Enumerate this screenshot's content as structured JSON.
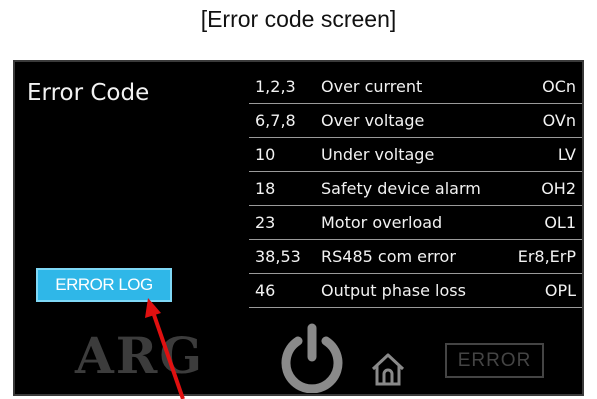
{
  "caption": "[Error code screen]",
  "screen": {
    "title": "Error Code",
    "rows": [
      {
        "code": "1,2,3",
        "description": "Over current",
        "abbr": "OCn"
      },
      {
        "code": "6,7,8",
        "description": "Over voltage",
        "abbr": "OVn"
      },
      {
        "code": "10",
        "description": "Under voltage",
        "abbr": "LV"
      },
      {
        "code": "18",
        "description": "Safety device alarm",
        "abbr": "OH2"
      },
      {
        "code": "23",
        "description": "Motor overload",
        "abbr": "OL1"
      },
      {
        "code": "38,53",
        "description": "RS485 com error",
        "abbr": "Er8,ErP"
      },
      {
        "code": "46",
        "description": "Output phase loss",
        "abbr": "OPL"
      }
    ],
    "error_log_button": "ERROR LOG",
    "logo": "ARG",
    "error_button": "ERROR",
    "icons": {
      "power": "power-icon",
      "home": "home-icon"
    }
  },
  "colors": {
    "screen_bg": "#000000",
    "button_blue": "#2fb7e8",
    "arrow": "#e01010"
  }
}
